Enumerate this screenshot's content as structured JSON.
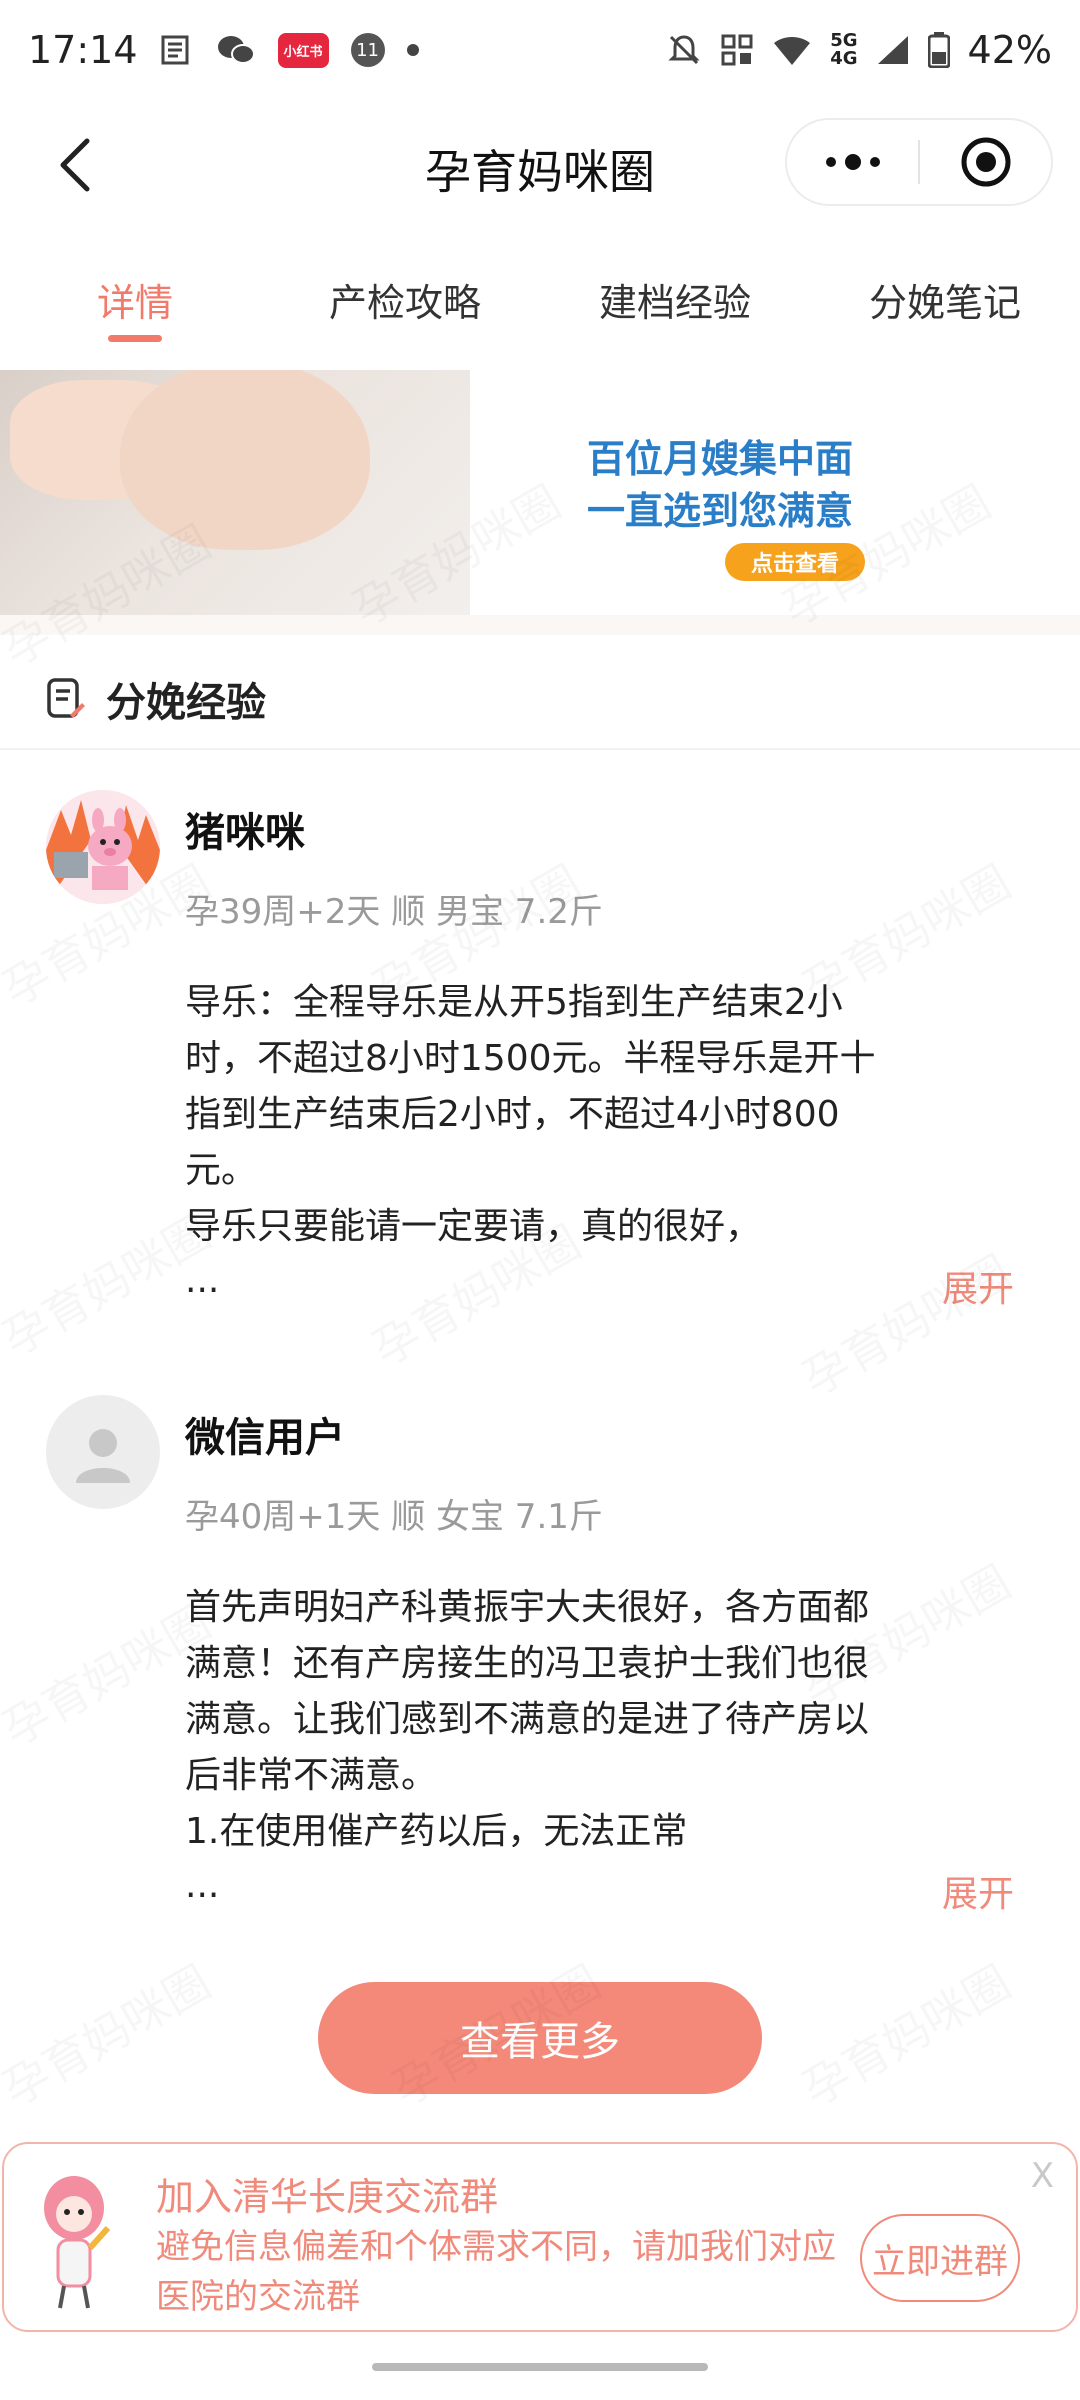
{
  "status_bar": {
    "time": "17:14",
    "notif_badge": "小红书",
    "notif_count": "11",
    "network_top": "5G",
    "network_bottom": "4G",
    "battery": "42%"
  },
  "header": {
    "title": "孕育妈咪圈"
  },
  "tabs": [
    {
      "label": "详情",
      "active": true
    },
    {
      "label": "产检攻略",
      "active": false
    },
    {
      "label": "建档经验",
      "active": false
    },
    {
      "label": "分娩笔记",
      "active": false
    }
  ],
  "banner": {
    "line1": "百位月嫂集中面",
    "line2": "一直选到您满意",
    "cta": "点击查看"
  },
  "section": {
    "title": "分娩经验"
  },
  "posts": [
    {
      "username": "猪咪咪",
      "meta": "孕39周+2天 顺 男宝 7.2斤",
      "content": "导乐：全程导乐是从开5指到生产结束2小\n时，不超过8小时1500元。半程导乐是开十\n指到生产结束后2小时，不超过4小时800\n元。\n导乐只要能请一定要请，真的很好，",
      "ellipsis": "...",
      "expand": "展开"
    },
    {
      "username": "微信用户",
      "meta": "孕40周+1天 顺 女宝 7.1斤",
      "content": "首先声明妇产科黄振宇大夫很好，各方面都\n满意！还有产房接生的冯卫袁护士我们也很\n满意。让我们感到不满意的是进了待产房以\n后非常不满意。\n1.在使用催产药以后，无法正常",
      "ellipsis": "...",
      "expand": "展开"
    }
  ],
  "more_button": "查看更多",
  "join_card": {
    "title": "加入清华长庚交流群",
    "desc": "避免信息偏差和个体需求不同，请加我们对应\n医院的交流群",
    "button": "立即进群",
    "close": "X"
  },
  "watermark": "孕育妈咪圈",
  "colors": {
    "accent": "#f17a6a",
    "button": "#f4897a",
    "banner_blue": "#2a7ec8",
    "banner_orange": "#f7a21d"
  }
}
